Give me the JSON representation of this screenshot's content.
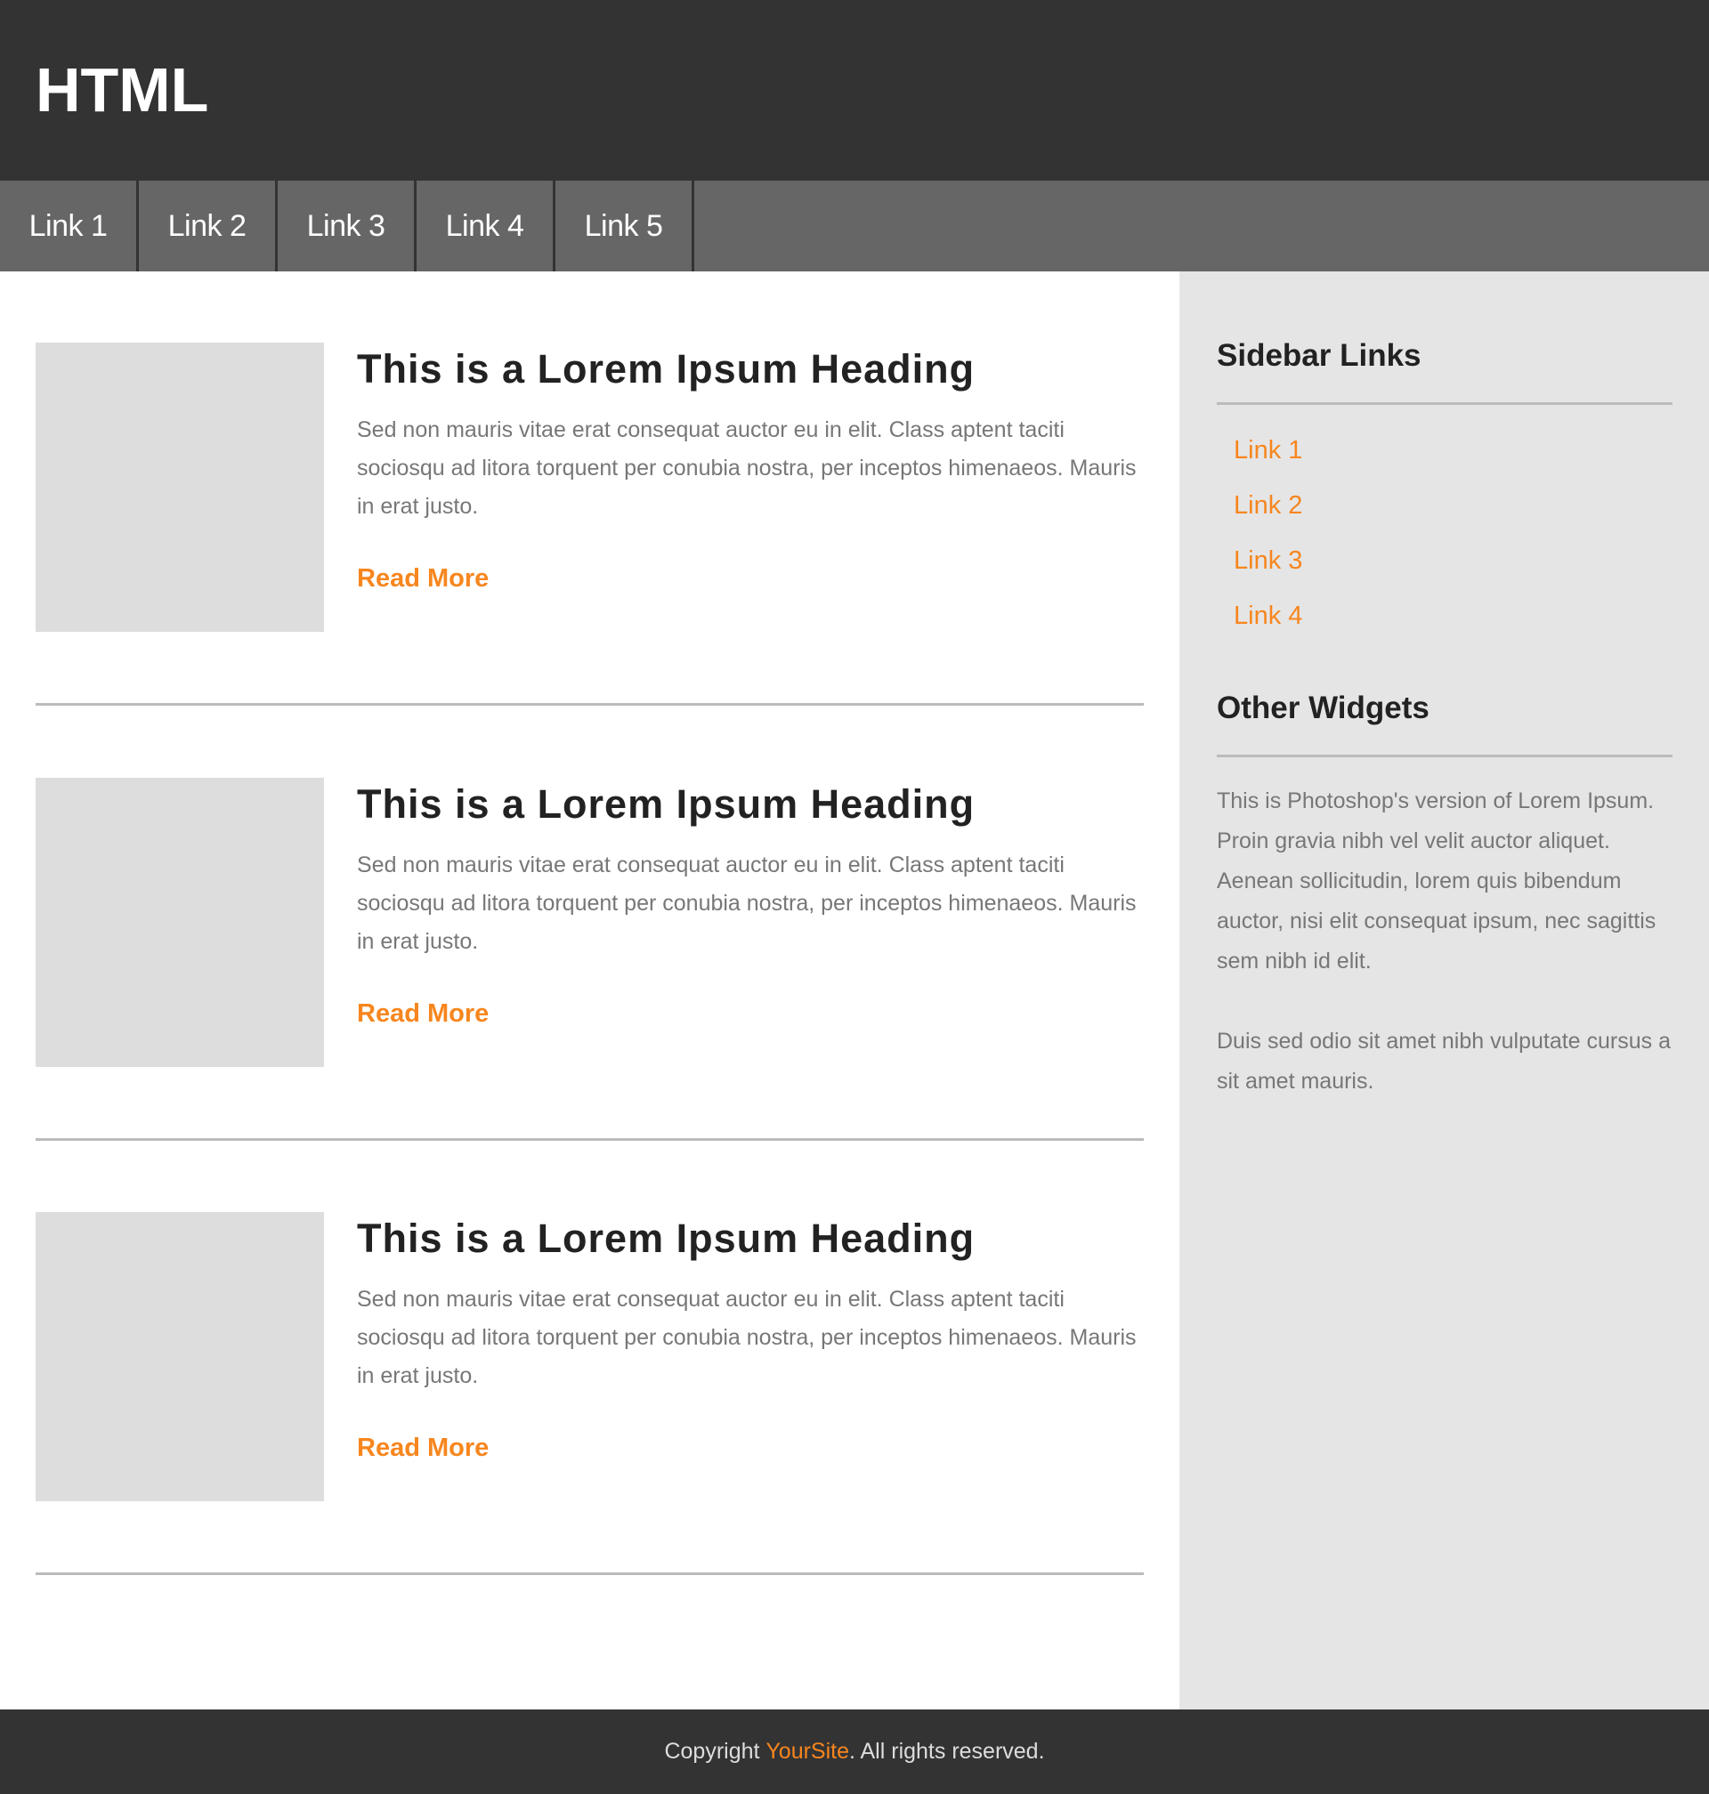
{
  "header": {
    "title": "HTML"
  },
  "nav": {
    "items": [
      {
        "label": "Link 1"
      },
      {
        "label": "Link 2"
      },
      {
        "label": "Link 3"
      },
      {
        "label": "Link 4"
      },
      {
        "label": "Link 5"
      }
    ]
  },
  "posts": [
    {
      "title": "This is a Lorem Ipsum Heading",
      "body": "Sed non mauris vitae erat consequat auctor eu in elit. Class aptent taciti sociosqu ad litora torquent per conubia nostra, per inceptos himenaeos. Mauris in erat justo.",
      "link": "Read More"
    },
    {
      "title": "This is a Lorem Ipsum Heading",
      "body": "Sed non mauris vitae erat consequat auctor eu in elit. Class aptent taciti sociosqu ad litora torquent per conubia nostra, per inceptos himenaeos. Mauris in erat justo.",
      "link": "Read More"
    },
    {
      "title": "This is a Lorem Ipsum Heading",
      "body": "Sed non mauris vitae erat consequat auctor eu in elit. Class aptent taciti sociosqu ad litora torquent per conubia nostra, per inceptos himenaeos. Mauris in erat justo.",
      "link": "Read More"
    }
  ],
  "sidebar": {
    "links_title": "Sidebar Links",
    "links": [
      {
        "label": "Link 1"
      },
      {
        "label": "Link 2"
      },
      {
        "label": "Link 3"
      },
      {
        "label": "Link 4"
      }
    ],
    "widgets_title": "Other Widgets",
    "widget_paragraphs": [
      "This is Photoshop's version of Lorem Ipsum. Proin gravia nibh vel velit auctor aliquet. Aenean sollicitudin, lorem quis bibendum auctor, nisi elit consequat ipsum, nec sagittis sem nibh id elit.",
      "Duis sed odio sit amet nibh vulputate cursus a sit amet mauris."
    ]
  },
  "footer": {
    "prefix": "Copyright ",
    "brand": "YourSite",
    "suffix": ". All rights reserved."
  },
  "colors": {
    "header_bg": "#333333",
    "nav_bg": "#666666",
    "sidebar_bg": "#e5e5e5",
    "accent": "#f7861e",
    "placeholder": "#dddddd"
  }
}
